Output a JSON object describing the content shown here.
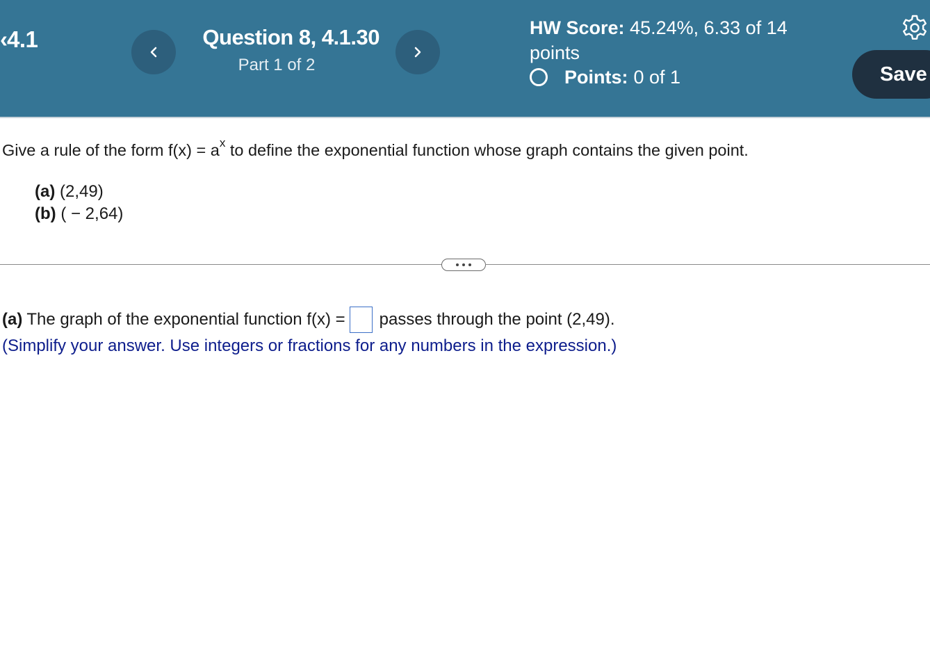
{
  "header": {
    "section": "4.1",
    "question_title": "Question 8, 4.1.30",
    "question_part": "Part 1 of 2",
    "hw_score_label": "HW Score:",
    "hw_score_value": "45.24%, 6.33 of 14 points",
    "points_label": "Points:",
    "points_value": "0 of 1",
    "save_label": "Save",
    "prev_icon": "chevron-left-icon",
    "next_icon": "chevron-right-icon",
    "settings_icon": "gear-icon"
  },
  "question": {
    "prompt_before": "Give a rule of the form f(x) = a",
    "prompt_superscript": "x",
    "prompt_after": " to define the exponential function whose graph contains the given point.",
    "parts": [
      {
        "label": "(a)",
        "text": "(2,49)"
      },
      {
        "label": "(b)",
        "text": "( − 2,64)"
      }
    ]
  },
  "answer": {
    "label": "(a)",
    "text_before": "The graph of the exponential function f(x) =",
    "input_value": "",
    "text_after": "passes through the point (2,49).",
    "instruction": "(Simplify your answer. Use integers or fractions for any numbers in the expression.)"
  },
  "colors": {
    "header_bg": "#357595",
    "nav_button_bg": "#2d5f7c",
    "save_bg": "#1f3040",
    "instruction_text": "#0d1d8c",
    "input_border": "#3b6fc7"
  }
}
